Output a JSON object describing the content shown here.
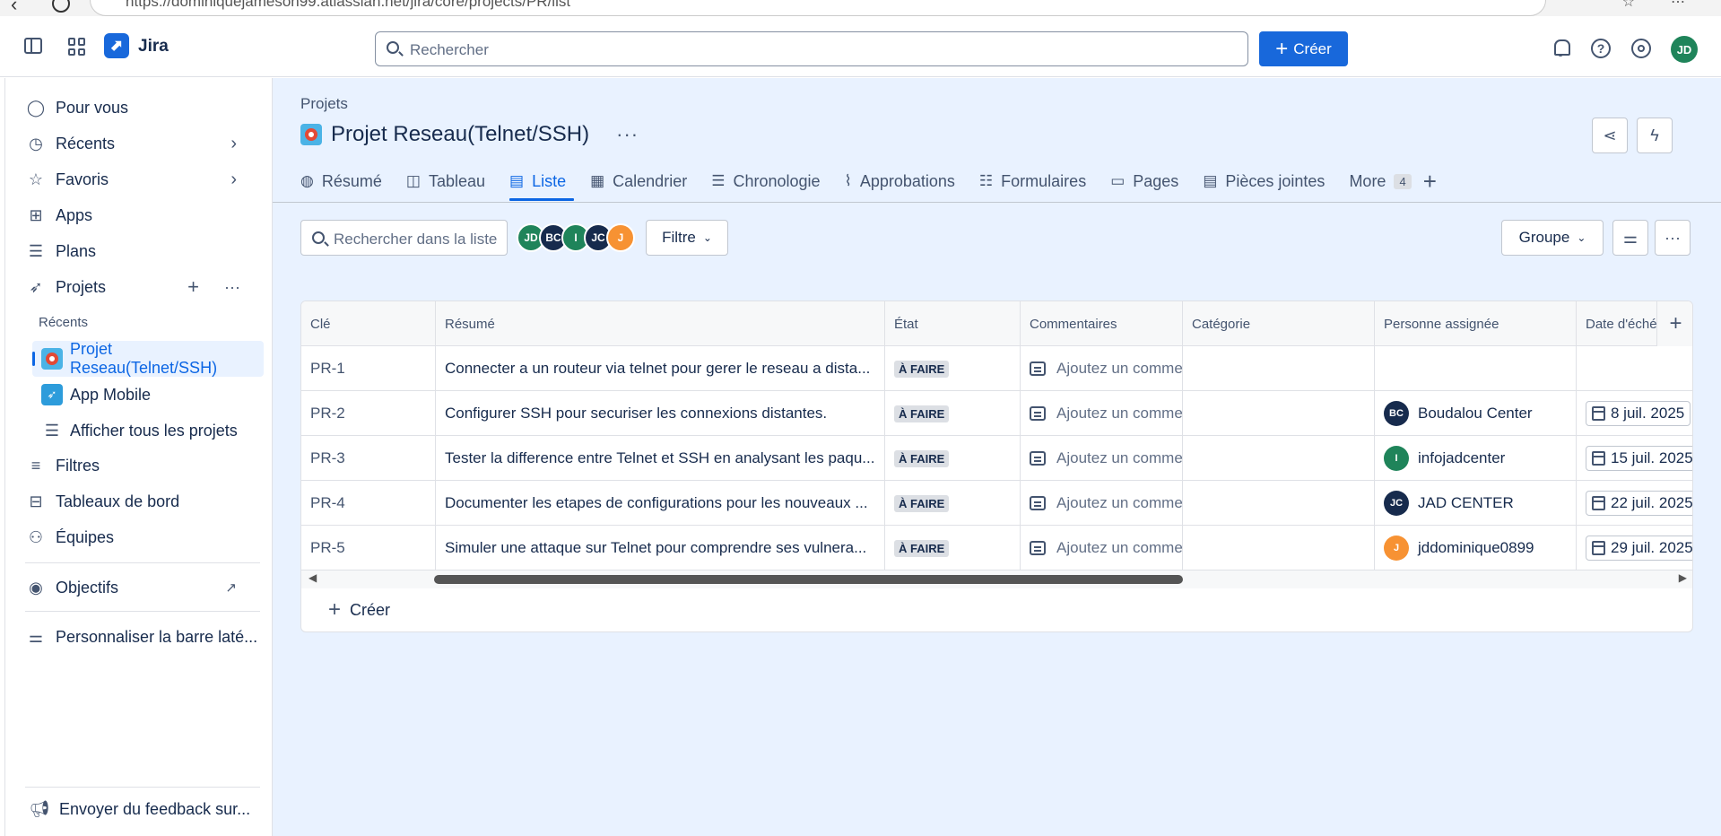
{
  "browser": {
    "url": "https://dominiquejameson99.atlassian.net/jira/core/projects/PR/list"
  },
  "topnav": {
    "app_name": "Jira",
    "search_placeholder": "Rechercher",
    "create_label": "Créer",
    "user_initials": "JD"
  },
  "sidebar": {
    "items": [
      {
        "label": "Pour vous",
        "icon": "person-circle-icon"
      },
      {
        "label": "Récents",
        "icon": "clock-icon"
      },
      {
        "label": "Favoris",
        "icon": "star-icon"
      },
      {
        "label": "Apps",
        "icon": "apps-icon"
      },
      {
        "label": "Plans",
        "icon": "plans-icon"
      },
      {
        "label": "Projets",
        "icon": "rocket-icon"
      }
    ],
    "recent_heading": "Récents",
    "projects": [
      {
        "label": "Projet Reseau(Telnet/SSH)"
      },
      {
        "label": "App Mobile"
      },
      {
        "label": "Afficher tous les projets"
      }
    ],
    "more_items": [
      {
        "label": "Filtres"
      },
      {
        "label": "Tableaux de bord"
      },
      {
        "label": "Équipes"
      }
    ],
    "objectives": "Objectifs",
    "customize": "Personnaliser la barre laté...",
    "feedback": "Envoyer du feedback sur..."
  },
  "main": {
    "breadcrumb": "Projets",
    "title": "Projet Reseau(Telnet/SSH)",
    "tabs": [
      {
        "label": "Résumé",
        "icon": "globe-icon"
      },
      {
        "label": "Tableau",
        "icon": "board-icon"
      },
      {
        "label": "Liste",
        "icon": "list-icon"
      },
      {
        "label": "Calendrier",
        "icon": "calendar-icon"
      },
      {
        "label": "Chronologie",
        "icon": "timeline-icon"
      },
      {
        "label": "Approbations",
        "icon": "paperclip-icon"
      },
      {
        "label": "Formulaires",
        "icon": "forms-icon"
      },
      {
        "label": "Pages",
        "icon": "page-icon"
      },
      {
        "label": "Pièces jointes",
        "icon": "attachments-icon"
      },
      {
        "label": "More",
        "icon": ""
      }
    ],
    "more_count": "4",
    "list_search_placeholder": "Rechercher dans la liste",
    "filter_label": "Filtre",
    "group_label": "Groupe",
    "avatars": [
      {
        "initials": "JD",
        "color": "#1f845a"
      },
      {
        "initials": "BC",
        "color": "#172b4d"
      },
      {
        "initials": "I",
        "color": "#1f845a"
      },
      {
        "initials": "JC",
        "color": "#172b4d"
      },
      {
        "initials": "J",
        "color": "#f79233"
      }
    ]
  },
  "table": {
    "columns": [
      "Clé",
      "Résumé",
      "État",
      "Commentaires",
      "Catégorie",
      "Personne assignée",
      "Date d'éché"
    ],
    "rows": [
      {
        "key": "PR-1",
        "summary": "Connecter a un routeur via telnet pour gerer le reseau a dista...",
        "state": "À FAIRE",
        "comment": "Ajoutez un comme",
        "assignee": "",
        "assignee_initials": "",
        "assignee_color": "",
        "due": ""
      },
      {
        "key": "PR-2",
        "summary": "Configurer SSH pour securiser les connexions distantes.",
        "state": "À FAIRE",
        "comment": "Ajoutez un comme",
        "assignee": "Boudalou Center",
        "assignee_initials": "BC",
        "assignee_color": "#172b4d",
        "due": "8 juil. 2025"
      },
      {
        "key": "PR-3",
        "summary": "Tester la difference entre Telnet et SSH en analysant les paqu...",
        "state": "À FAIRE",
        "comment": "Ajoutez un comme",
        "assignee": "infojadcenter",
        "assignee_initials": "I",
        "assignee_color": "#1f845a",
        "due": "15 juil. 2025"
      },
      {
        "key": "PR-4",
        "summary": "Documenter les etapes de configurations pour les nouveaux ...",
        "state": "À FAIRE",
        "comment": "Ajoutez un comme",
        "assignee": "JAD CENTER",
        "assignee_initials": "JC",
        "assignee_color": "#172b4d",
        "due": "22 juil. 2025"
      },
      {
        "key": "PR-5",
        "summary": "Simuler une attaque sur Telnet pour comprendre ses vulnera...",
        "state": "À FAIRE",
        "comment": "Ajoutez un comme",
        "assignee": "jddominique0899",
        "assignee_initials": "J",
        "assignee_color": "#f79233",
        "due": "29 juil. 2025"
      }
    ],
    "create_label": "Créer"
  }
}
